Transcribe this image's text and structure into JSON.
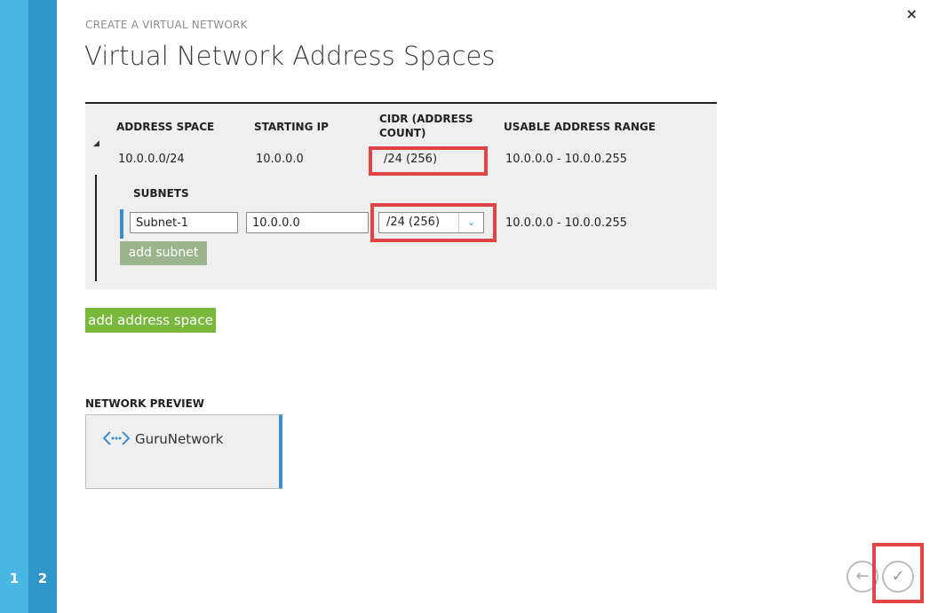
{
  "wizard": {
    "steps": [
      "1",
      "2"
    ],
    "breadcrumb": "CREATE A VIRTUAL NETWORK",
    "title": "Virtual Network Address Spaces",
    "close_icon": "×"
  },
  "address_table": {
    "headers": {
      "address_space": "ADDRESS SPACE",
      "starting_ip": "STARTING IP",
      "cidr_line1": "CIDR (ADDRESS",
      "cidr_line2": "COUNT)",
      "usable_range": "USABLE ADDRESS RANGE"
    },
    "row": {
      "address_space": "10.0.0.0/24",
      "starting_ip": "10.0.0.0",
      "cidr": "/24 (256)",
      "usable_range": "10.0.0.0 - 10.0.0.255"
    },
    "subnets": {
      "heading": "SUBNETS",
      "rows": [
        {
          "name": "Subnet-1",
          "starting_ip": "10.0.0.0",
          "cidr": "/24 (256)",
          "usable_range": "10.0.0.0 - 10.0.0.255"
        }
      ],
      "add_button": "add subnet"
    },
    "add_address_space_button": "add address space"
  },
  "preview": {
    "heading": "NETWORK PREVIEW",
    "network_name": "GuruNetwork",
    "icon": "network-icon"
  },
  "nav": {
    "back_icon": "←",
    "complete_icon": "✓"
  },
  "colors": {
    "step1": "#4ab6e3",
    "step2": "#2f96c9",
    "add_button": "#7ab83d",
    "highlight": "#e04444"
  }
}
